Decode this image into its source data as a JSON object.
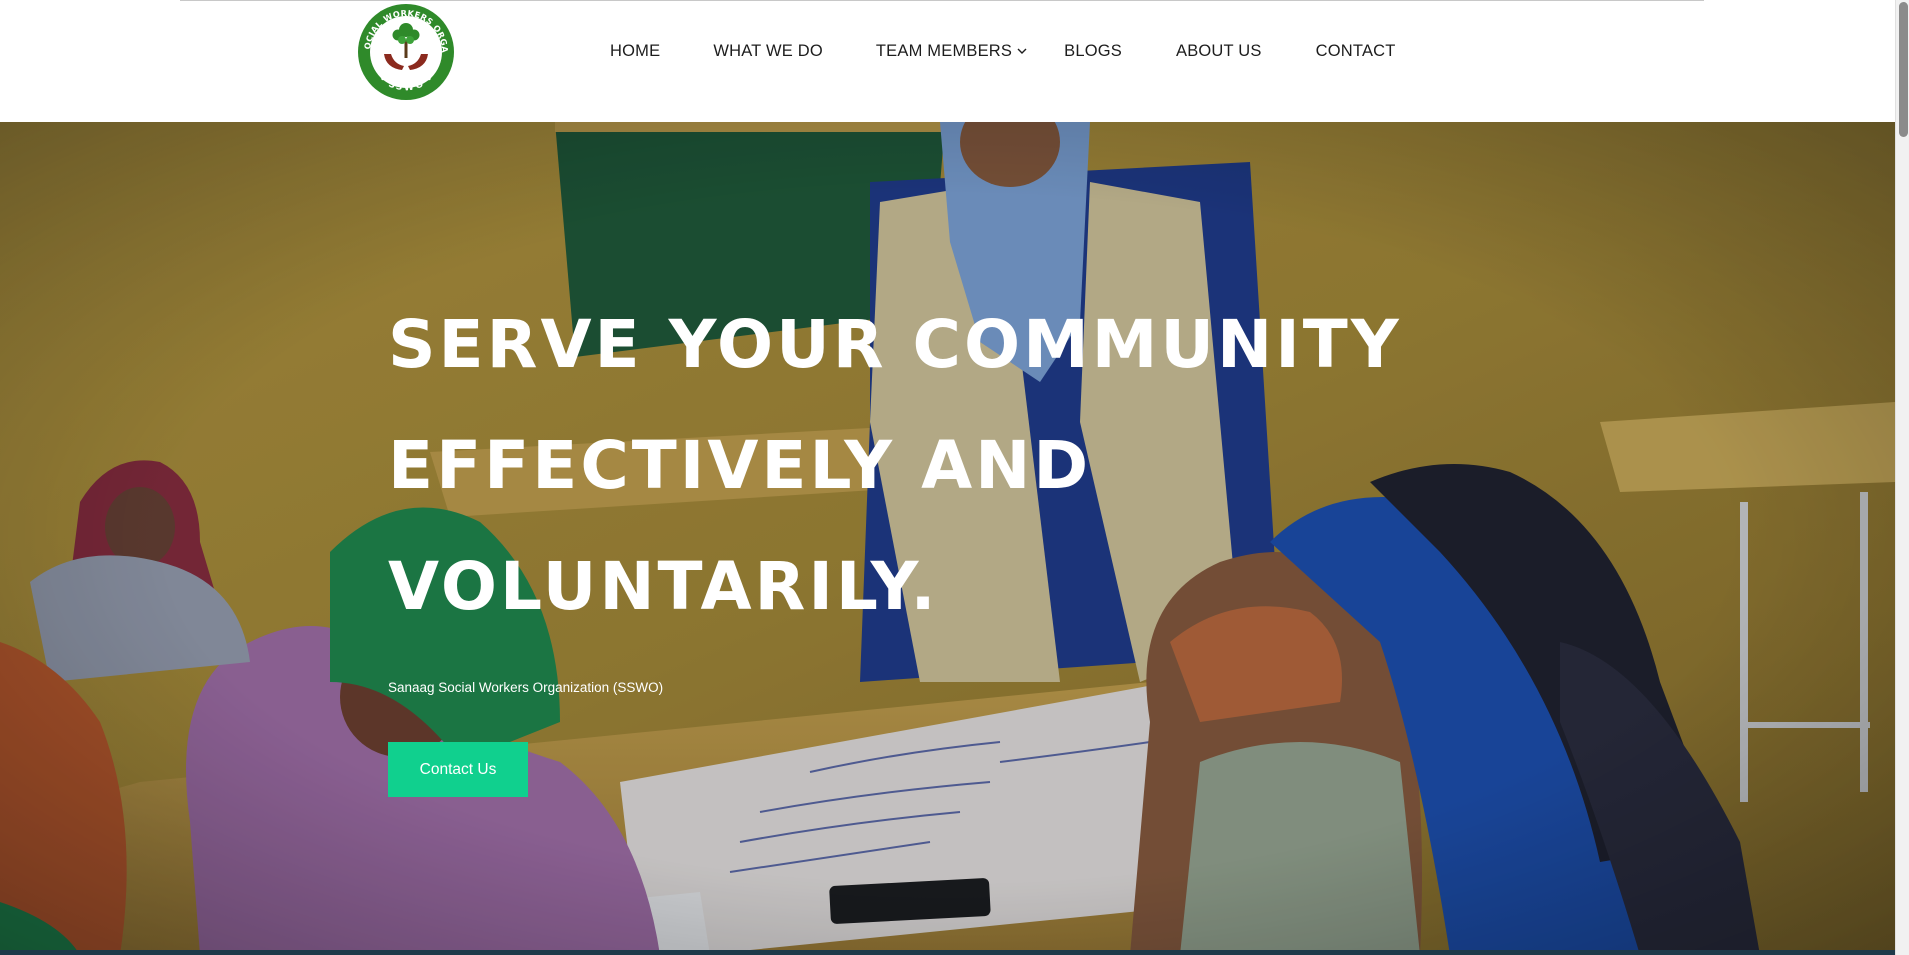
{
  "logo": {
    "ring_text": "SANAAG SOCIAL WORKERS ORGANIZATION",
    "short_name": "SSWO",
    "ring_color": "#2f8a2a",
    "tree_color": "#2f8a2a",
    "hands_color": "#8b2a1e"
  },
  "nav": {
    "items": [
      {
        "label": "HOME"
      },
      {
        "label": "WHAT WE DO"
      },
      {
        "label": "TEAM MEMBERS",
        "has_dropdown": true
      },
      {
        "label": "BLOGS"
      },
      {
        "label": "ABOUT US"
      },
      {
        "label": "CONTACT"
      }
    ]
  },
  "hero": {
    "headline_lines": [
      "SERVE YOUR COMMUNITY",
      "EFFECTIVELY AND",
      "VOLUNTARILY."
    ],
    "subtitle": "Sanaag Social Workers Organization (SSWO)",
    "cta_label": "Contact Us",
    "cta_color": "#10d08e"
  }
}
